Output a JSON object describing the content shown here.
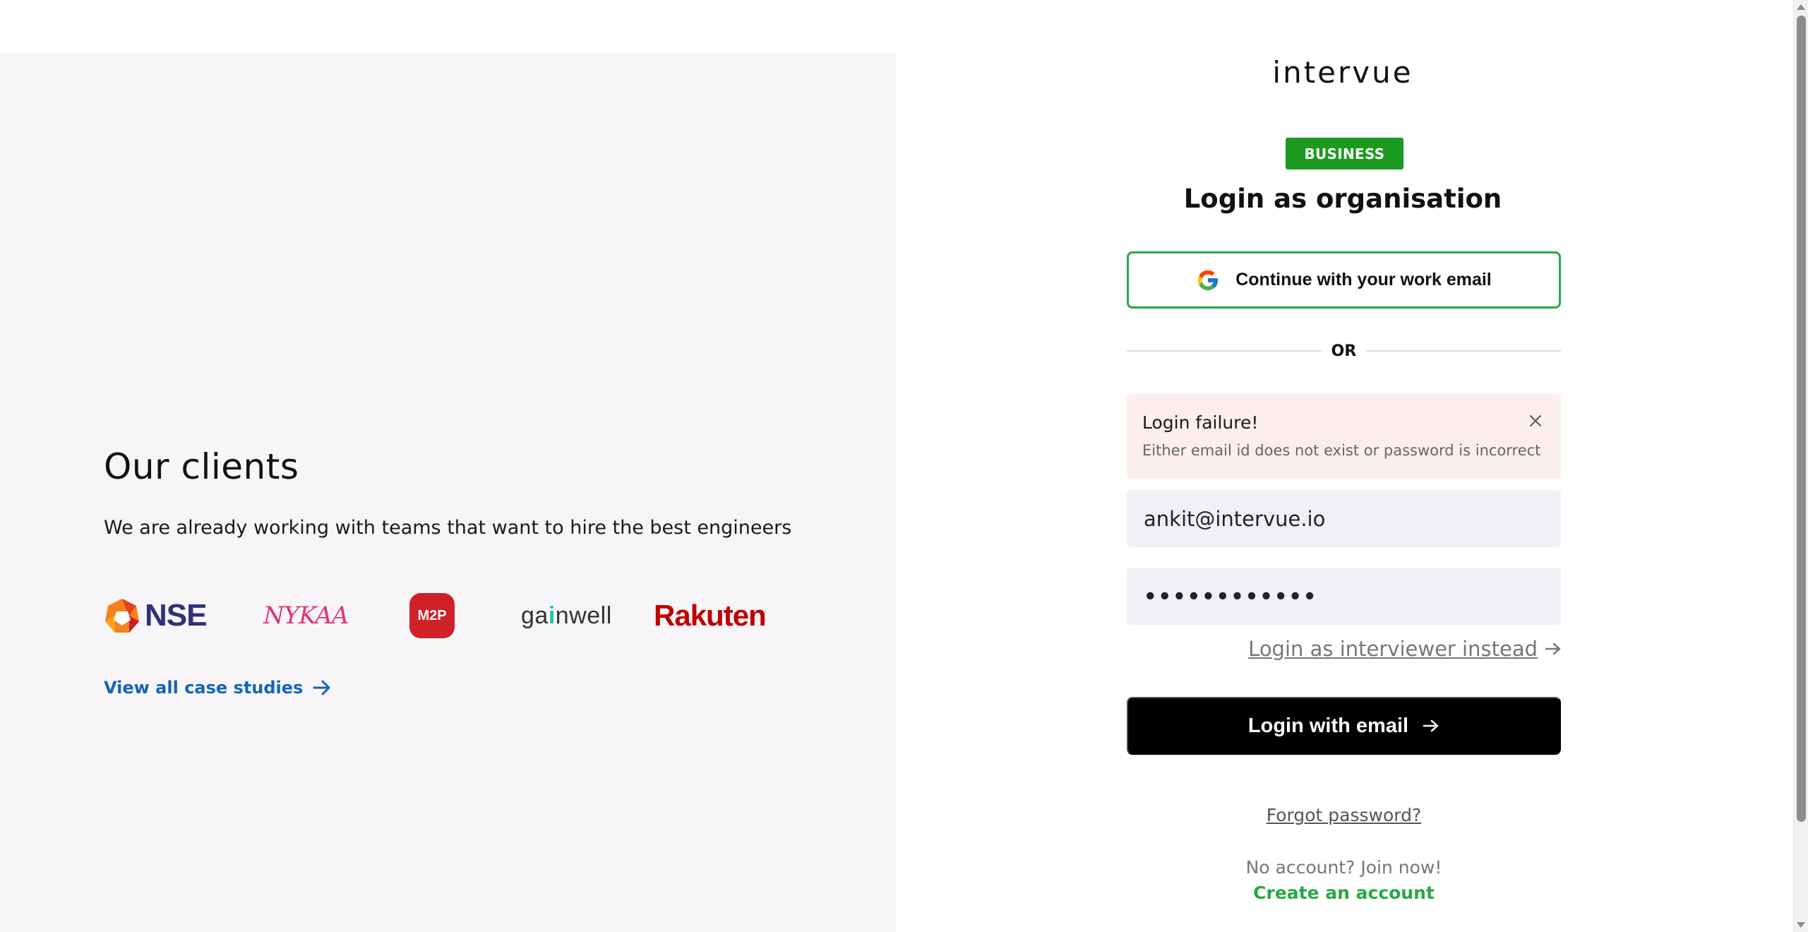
{
  "clients": {
    "title": "Our clients",
    "subtitle": "We are already working with teams that want to hire the best engineers",
    "logos": {
      "nse": "NSE",
      "nykaa": "NYKAA",
      "m2p": "M2P",
      "gainwell_prefix": "ga",
      "gainwell_accent": "i",
      "gainwell_suffix": "nwell",
      "rakuten": "Rakuten"
    },
    "case_studies_link": "View all case studies"
  },
  "brand": {
    "logo_text": "intervue"
  },
  "login": {
    "badge": "BUSINESS",
    "title": "Login as organisation",
    "google_button": "Continue with your work email",
    "divider": "OR",
    "error": {
      "title": "Login failure!",
      "message": "Either email id does not exist or password is incorrect"
    },
    "email_value": "ankit@intervue.io",
    "password_value": "••••••••••••",
    "interviewer_link": "Login as interviewer instead",
    "submit_button": "Login with email",
    "forgot_password": "Forgot password?",
    "no_account": "No account? Join now!",
    "create_account": "Create an account"
  },
  "colors": {
    "accent_green": "#2aa845",
    "badge_green": "#1b9a1f",
    "link_blue": "#1464b8",
    "error_bg": "#fdeeee",
    "left_panel_bg": "#f7f5f7"
  },
  "icons": [
    "google-icon",
    "close-icon",
    "arrow-right-icon",
    "nse-logo-icon"
  ]
}
